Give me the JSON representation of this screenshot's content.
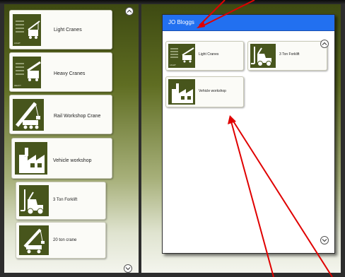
{
  "left_list": {
    "items": [
      {
        "label": "Light Cranes",
        "thumb_label": "LIGHT",
        "icon": "light-crane-icon"
      },
      {
        "label": "Heavy Cranes",
        "thumb_label": "HEAVY",
        "icon": "heavy-crane-icon"
      },
      {
        "label": "Rail Workshop Crane",
        "icon": "rail-crane-icon"
      },
      {
        "label": "Vehicle workshop",
        "icon": "factory-icon"
      },
      {
        "label": "3 Ton Forklift",
        "icon": "forklift-icon"
      },
      {
        "label": "20 ton crane",
        "icon": "mobile-crane-icon"
      }
    ]
  },
  "dialog": {
    "title": "JO Bloggs",
    "items": [
      {
        "label": "Light Cranes",
        "thumb_label": "LIGHT",
        "icon": "light-crane-icon"
      },
      {
        "label": "3 Ton Forklift",
        "icon": "forklift-icon"
      },
      {
        "label": "Vehicle workshop",
        "icon": "factory-icon"
      }
    ]
  },
  "colors": {
    "panel_dark": "#3e4a12",
    "thumb_green": "#47551c",
    "header_blue": "#2270f0",
    "annotation_red": "#e00000"
  }
}
